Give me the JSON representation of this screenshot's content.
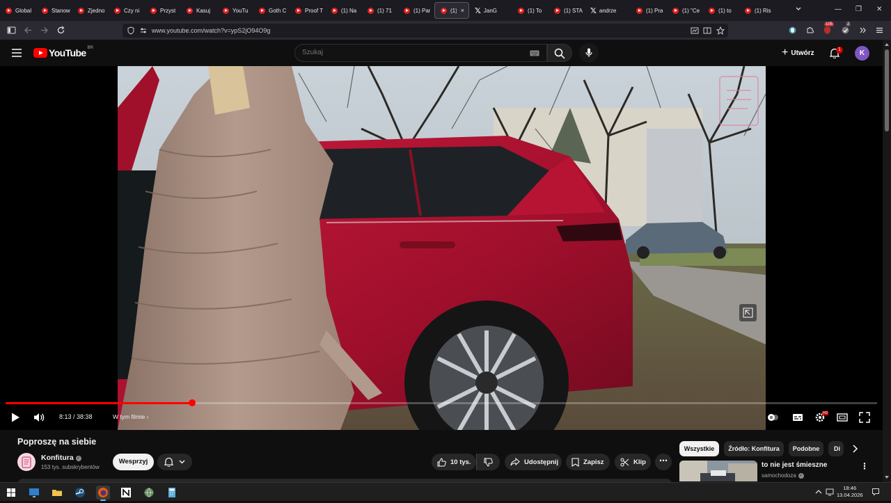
{
  "browser": {
    "tabs": [
      {
        "label": "Global",
        "icon": "youtube-icon"
      },
      {
        "label": "Stanow",
        "icon": "youtube-icon"
      },
      {
        "label": "Zjedno",
        "icon": "youtube-icon"
      },
      {
        "label": "Czy ni",
        "icon": "youtube-icon"
      },
      {
        "label": "Przyst",
        "icon": "youtube-icon"
      },
      {
        "label": "Kasuj",
        "icon": "youtube-icon"
      },
      {
        "label": "YouTu",
        "icon": "youtube-icon"
      },
      {
        "label": "Goth C",
        "icon": "youtube-icon"
      },
      {
        "label": "Proof T",
        "icon": "youtube-icon"
      },
      {
        "label": "(1) Na",
        "icon": "youtube-icon"
      },
      {
        "label": "(1) 71",
        "icon": "youtube-icon"
      },
      {
        "label": "(1) Par",
        "icon": "youtube-icon"
      },
      {
        "label": "(1) K",
        "icon": "youtube-icon",
        "active": true
      },
      {
        "label": "JanG",
        "icon": "x-icon"
      },
      {
        "label": "(1) To",
        "icon": "youtube-icon"
      },
      {
        "label": "(1) STA",
        "icon": "youtube-icon"
      },
      {
        "label": "andrze",
        "icon": "x-icon"
      },
      {
        "label": "(1) Pra",
        "icon": "youtube-icon"
      },
      {
        "label": "(1) \"Ce",
        "icon": "youtube-icon"
      },
      {
        "label": "(1) to",
        "icon": "youtube-icon"
      },
      {
        "label": "(1) Ris",
        "icon": "youtube-icon"
      }
    ],
    "active_tab_close": "×",
    "url": "www.youtube.com/watch?v=ypS2jO94O9g",
    "ext_badge_1": "105",
    "ext_badge_2": "2"
  },
  "youtube": {
    "logo_text": "YouTube",
    "logo_country": "BR",
    "search_placeholder": "Szukaj",
    "create_label": "Utwórz",
    "notifications_count": "1",
    "avatar_letter": "K"
  },
  "player": {
    "progress_fraction": 0.2137,
    "time_current": "8:13",
    "time_separator": " / ",
    "time_total": "38:38",
    "chapter_label": "W tym filmie",
    "hd_label": "HD"
  },
  "video": {
    "title": "Poproszę na siebie",
    "channel_name": "Konfitura",
    "subscribers": "153 tys. subskrybentów",
    "support_label": "Wesprzyj",
    "likes": "10 tys.",
    "share_label": "Udostępnij",
    "save_label": "Zapisz",
    "clip_label": "Klip"
  },
  "sidebar": {
    "chips": [
      "Wszystkie",
      "Źródło: Konfitura",
      "Podobne",
      "Di"
    ],
    "recommendation": {
      "title": "to nie jest śmieszne",
      "channel": "samochodoza"
    }
  },
  "taskbar": {
    "time": "18:46",
    "date": "13.04.2026"
  },
  "colors": {
    "accent": "#ff0000",
    "background": "#0f0f0f",
    "pill": "#272727",
    "avatar": "#7e57c2"
  }
}
